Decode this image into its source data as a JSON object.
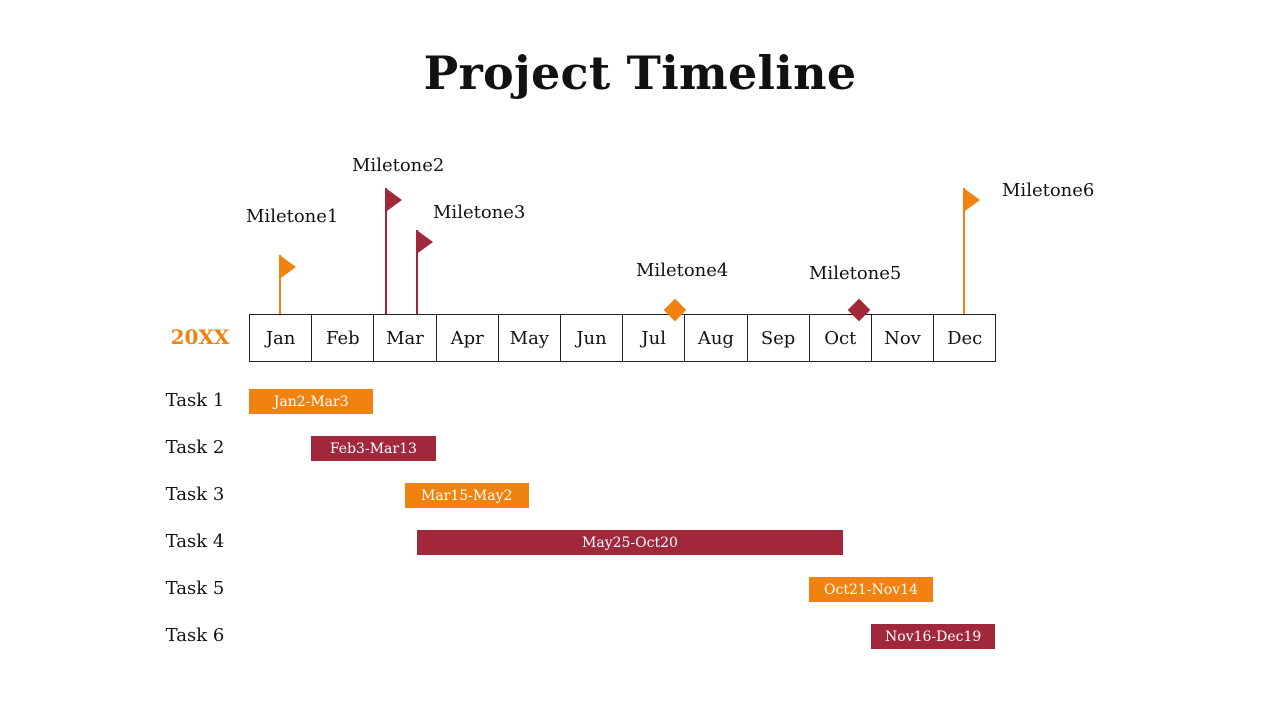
{
  "colors": {
    "orange": "#F0820F",
    "crimson": "#A0283A"
  },
  "chart_data": {
    "type": "gantt",
    "title": "Project Timeline",
    "year_label": "20XX",
    "months": [
      "Jan",
      "Feb",
      "Mar",
      "Apr",
      "May",
      "Jun",
      "Jul",
      "Aug",
      "Sep",
      "Oct",
      "Nov",
      "Dec"
    ],
    "tasks": [
      {
        "name": "Task 1",
        "label": "Jan2-Mar3",
        "start_month": 0.0,
        "end_month": 2.0,
        "color": "orange"
      },
      {
        "name": "Task 2",
        "label": "Feb3-Mar13",
        "start_month": 1.0,
        "end_month": 3.0,
        "color": "crimson"
      },
      {
        "name": "Task 3",
        "label": "Mar15-May2",
        "start_month": 2.5,
        "end_month": 4.5,
        "color": "orange"
      },
      {
        "name": "Task 4",
        "label": "May25-Oct20",
        "start_month": 2.7,
        "end_month": 9.55,
        "color": "crimson"
      },
      {
        "name": "Task 5",
        "label": "Oct21-Nov14",
        "start_month": 9.0,
        "end_month": 11.0,
        "color": "orange"
      },
      {
        "name": "Task 6",
        "label": "Nov16-Dec19",
        "start_month": 10.0,
        "end_month": 12.0,
        "color": "crimson"
      }
    ],
    "milestones": [
      {
        "name": "Miletone1",
        "month": 0.5,
        "marker": "flag",
        "color": "orange",
        "level": 1
      },
      {
        "name": "Miletone2",
        "month": 2.2,
        "marker": "flag",
        "color": "crimson",
        "level": 3
      },
      {
        "name": "Miletone3",
        "month": 2.7,
        "marker": "flag",
        "color": "crimson",
        "level": 2
      },
      {
        "name": "Miletone4",
        "month": 6.85,
        "marker": "diamond",
        "color": "orange",
        "level": 0
      },
      {
        "name": "Miletone5",
        "month": 9.8,
        "marker": "diamond",
        "color": "crimson",
        "level": 0
      },
      {
        "name": "Miletone6",
        "month": 11.5,
        "marker": "flag",
        "color": "orange",
        "level": 3
      }
    ]
  }
}
